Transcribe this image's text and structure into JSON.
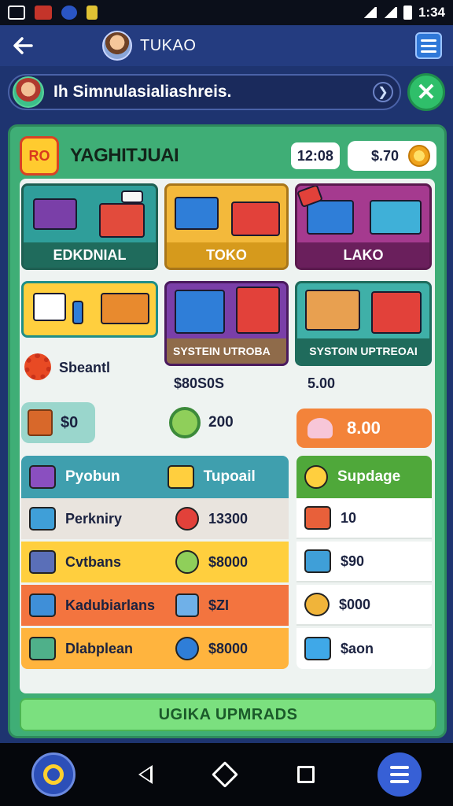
{
  "status_bar": {
    "time": "1:34"
  },
  "app_bar": {
    "title": "TUKAO"
  },
  "search": {
    "text": "Ih Simnulasialiashreis."
  },
  "panel": {
    "title": "YAGHITJUAI",
    "logo_text": "RO",
    "time_badge": "12:08",
    "coins": "$.70"
  },
  "shop_cards": [
    {
      "label": "EDKDNIAL",
      "color": "#1f6b5c"
    },
    {
      "label": "TOKO",
      "color": "#d69a1c"
    },
    {
      "label": "LAKO",
      "color": "#6a1f5c"
    }
  ],
  "upgrade_cards": [
    {
      "label": "SYSTEIN UTROBA",
      "value": "$80S0S"
    },
    {
      "label": "SYSTOIN UPTREOAI",
      "value": "5.00"
    }
  ],
  "mid": {
    "gear_label": "Sbeantl",
    "cash_label": "$0",
    "coin_value": "200",
    "buy_price": "8.00"
  },
  "list": {
    "head_left": "Pyobun",
    "head_mid": "Tupoail",
    "head_right": "Supdage",
    "rows": [
      {
        "name": "Perkniry",
        "value": "13300",
        "side": "10",
        "bg": "#e9e4de"
      },
      {
        "name": "Cvtbans",
        "value": "$8000",
        "side": "$90",
        "bg": "#ffcf3e"
      },
      {
        "name": "Kadubiarlans",
        "value": "$ZI",
        "side": "$000",
        "bg": "#f3743f"
      },
      {
        "name": "Dlabplean",
        "value": "$8000",
        "side": "$aon",
        "bg": "#ffb43e"
      }
    ]
  },
  "footer": {
    "button": "UGIKA UPMRADS"
  },
  "icons": {
    "back": "arrow-left-icon",
    "menu": "list-menu-icon",
    "close": "close-icon",
    "chevron": "chevron-right-icon"
  }
}
